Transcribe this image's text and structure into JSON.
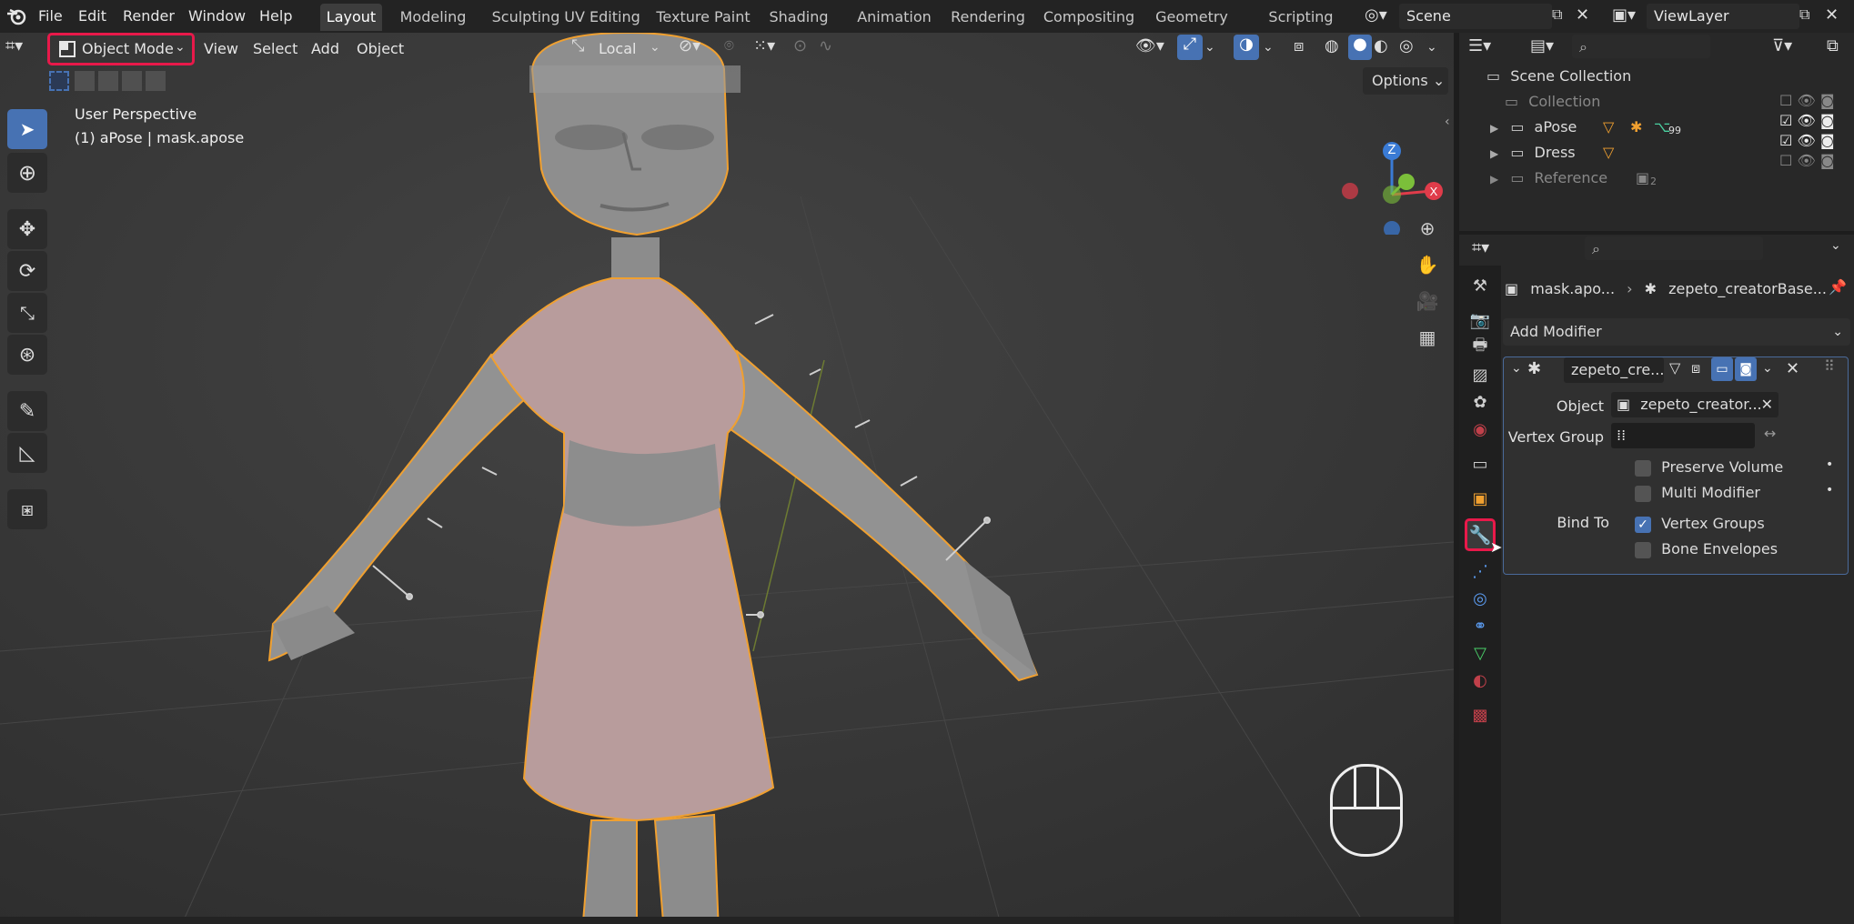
{
  "menubar": {
    "items": [
      "File",
      "Edit",
      "Render",
      "Window",
      "Help"
    ],
    "workspaces": [
      "Layout",
      "Modeling",
      "Sculpting",
      "UV Editing",
      "Texture Paint",
      "Shading",
      "Animation",
      "Rendering",
      "Compositing",
      "Geometry Nodes",
      "Scripting"
    ],
    "active_workspace": "Layout",
    "scene": "Scene",
    "view_layer": "ViewLayer"
  },
  "viewport": {
    "mode": "Object Mode",
    "menus": [
      "View",
      "Select",
      "Add",
      "Object"
    ],
    "orientation": "Local",
    "options_label": "Options",
    "info_line1": "User Perspective",
    "info_line2": "(1) aPose | mask.apose",
    "gizmo_z": "Z"
  },
  "outliner": {
    "root": "Scene Collection",
    "items": [
      {
        "name": "Collection",
        "badge": ""
      },
      {
        "name": "aPose",
        "badge": "99"
      },
      {
        "name": "Dress",
        "badge": ""
      },
      {
        "name": "Reference",
        "badge": "2"
      }
    ]
  },
  "properties": {
    "breadcrumb_object": "mask.apo...",
    "breadcrumb_modifier": "zepeto_creatorBase...",
    "add_modifier": "Add Modifier",
    "modifier_name": "zepeto_cre...",
    "object_label": "Object",
    "object_value": "zepeto_creator...",
    "vertex_group_label": "Vertex Group",
    "preserve_volume": "Preserve Volume",
    "multi_modifier": "Multi Modifier",
    "bind_to_label": "Bind To",
    "vertex_groups": "Vertex Groups",
    "bone_envelopes": "Bone Envelopes"
  },
  "colors": {
    "accent": "#4772b3",
    "highlight": "#e8194a",
    "selection_outline": "#f0a030"
  }
}
